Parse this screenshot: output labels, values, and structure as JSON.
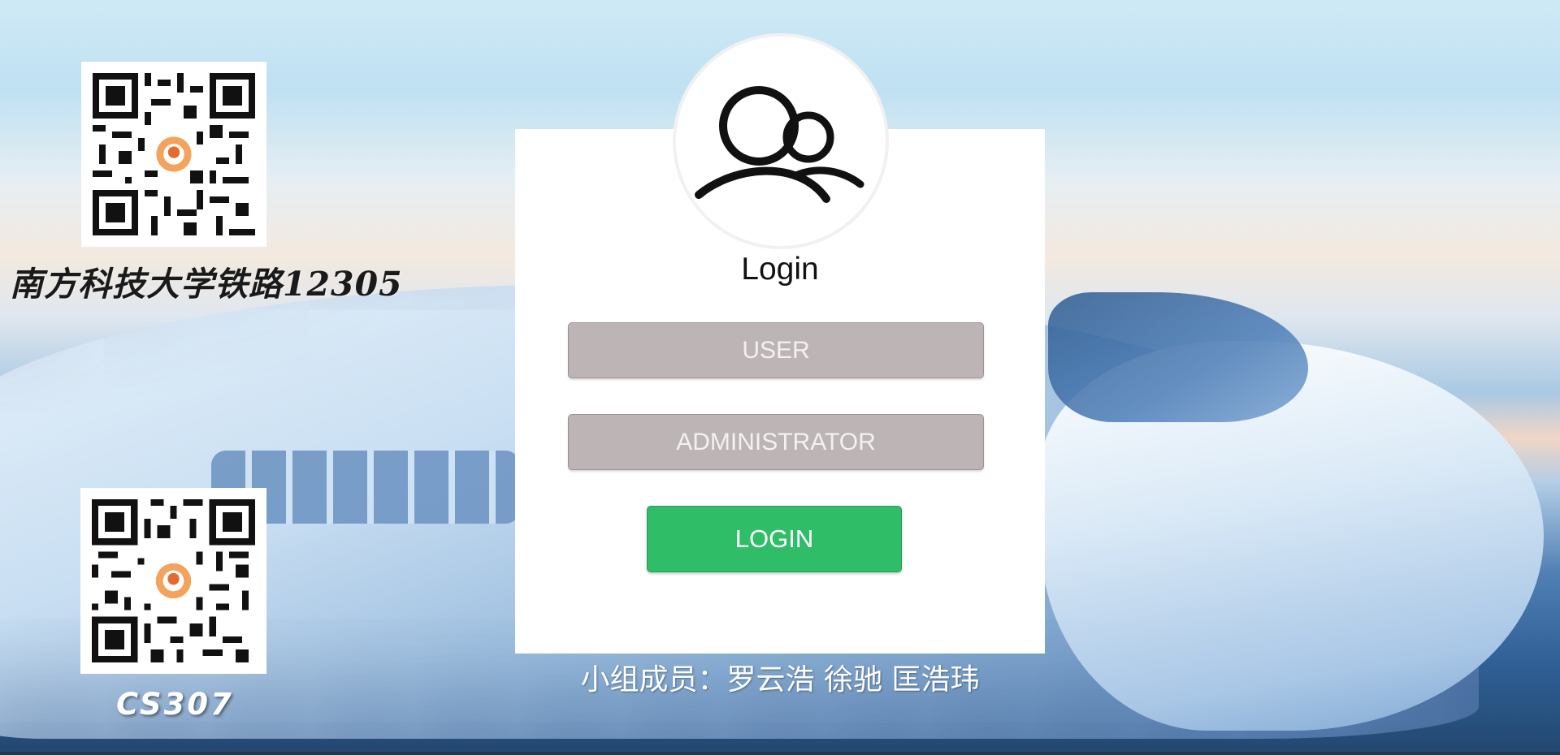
{
  "brand": {
    "title": "南方科技大学铁路12305",
    "course": "CS307"
  },
  "login": {
    "title": "Login",
    "role_user_label": "USER",
    "role_admin_label": "ADMINISTRATOR",
    "submit_label": "LOGIN"
  },
  "footer": {
    "members": "小组成员：罗云浩 徐驰 匡浩玮"
  },
  "colors": {
    "role_button_bg": "#bdb4b5",
    "login_button_bg": "#2fbd68",
    "panel_bg": "#ffffff"
  },
  "icons": {
    "avatar": "users-icon",
    "qr_top": "qr-code",
    "qr_bottom": "qr-code"
  }
}
